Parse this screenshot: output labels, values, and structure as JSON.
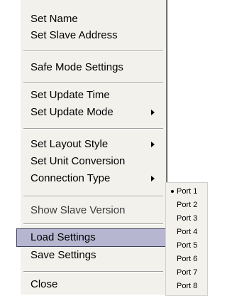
{
  "menu": {
    "items": [
      {
        "label": "Set Name"
      },
      {
        "label": "Set Slave Address"
      },
      {
        "label": "Safe Mode Settings"
      },
      {
        "label": "Set Update Time"
      },
      {
        "label": "Set Update Mode",
        "submenu": true
      },
      {
        "label": "Set Layout Style",
        "submenu": true
      },
      {
        "label": "Set Unit Conversion"
      },
      {
        "label": "Connection Type",
        "submenu": true
      },
      {
        "label": "Show Slave Version"
      },
      {
        "label": "Load Settings",
        "highlighted": true
      },
      {
        "label": "Save Settings"
      },
      {
        "label": "Close"
      }
    ]
  },
  "connection_submenu": {
    "items": [
      {
        "label": "Port 1",
        "selected": true
      },
      {
        "label": "Port 2"
      },
      {
        "label": "Port 3"
      },
      {
        "label": "Port 4"
      },
      {
        "label": "Port 5"
      },
      {
        "label": "Port 6"
      },
      {
        "label": "Port 7"
      },
      {
        "label": "Port 8"
      }
    ]
  },
  "colors": {
    "menu_bg": "#f2f1ec",
    "highlight_bg": "#b6b6d0",
    "highlight_border": "#404060",
    "text": "#000000"
  },
  "icons": {
    "submenu_arrow": "chevron-right-icon",
    "selected_marker": "bullet-icon"
  }
}
